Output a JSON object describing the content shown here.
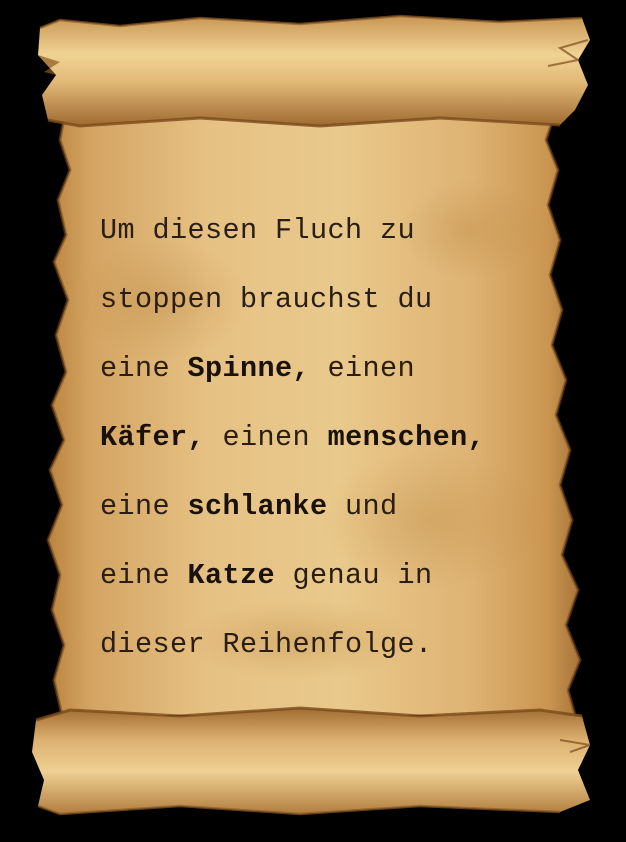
{
  "scroll": {
    "colors": {
      "background": "#000000",
      "parchment_light": "#e9c989",
      "parchment_mid": "#d6aa68",
      "parchment_dark": "#a87535",
      "edge_burn": "#7a4a1c",
      "ink": "#2a1e12"
    },
    "lines": [
      [
        {
          "text": "Um diesen Fluch zu",
          "bold": false
        }
      ],
      [
        {
          "text": "stoppen brauchst du",
          "bold": false
        }
      ],
      [
        {
          "text": "eine ",
          "bold": false
        },
        {
          "text": "Spinne,",
          "bold": true
        },
        {
          "text": " einen",
          "bold": false
        }
      ],
      [
        {
          "text": "Käfer,",
          "bold": true
        },
        {
          "text": " einen ",
          "bold": false
        },
        {
          "text": "menschen,",
          "bold": true
        }
      ],
      [
        {
          "text": "eine ",
          "bold": false
        },
        {
          "text": "schlanke",
          "bold": true
        },
        {
          "text": " und",
          "bold": false
        }
      ],
      [
        {
          "text": "eine ",
          "bold": false
        },
        {
          "text": "Katze",
          "bold": true
        },
        {
          "text": " genau in",
          "bold": false
        }
      ],
      [
        {
          "text": "dieser Reihenfolge.",
          "bold": false
        }
      ]
    ]
  }
}
